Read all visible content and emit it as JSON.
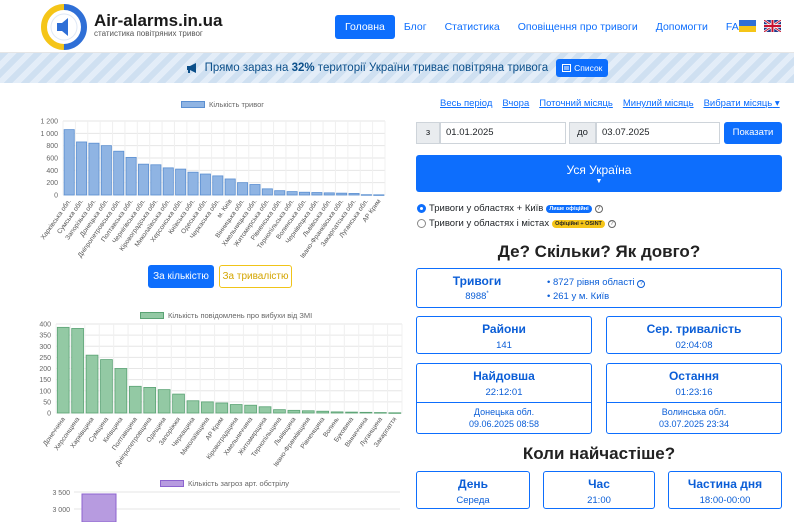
{
  "header": {
    "brand": "Air-alarms.in.ua",
    "subtitle": "статистика повітряних тривог",
    "nav": [
      "Головна",
      "Блог",
      "Статистика",
      "Оповіщення про тривоги",
      "Допомогти",
      "FAQs"
    ],
    "active_index": 0
  },
  "banner": {
    "prefix": "Прямо зараз на ",
    "percent": "32%",
    "suffix": " території України триває повітряна тривога",
    "button": "Список"
  },
  "chart1": {
    "legend": "Кількість тривог",
    "color": "#8fb4e3",
    "border": "#5b8fd1",
    "ylim": [
      0,
      1200
    ],
    "yticks": [
      "1 200",
      "1 000",
      "800",
      "600",
      "400",
      "200",
      "0"
    ],
    "categories": [
      "Харківська обл.",
      "Сумська обл.",
      "Запорізька обл.",
      "Донецька обл.",
      "Дніпропетровська обл.",
      "Полтавська обл.",
      "Чернігівська обл.",
      "Кіровоградська обл.",
      "Миколаївська обл.",
      "Херсонська обл.",
      "Київська обл.",
      "Одеська обл.",
      "Черкаська обл.",
      "м. Київ",
      "Вінницька обл.",
      "Хмельницька обл.",
      "Житомирська обл.",
      "Рівненська обл.",
      "Тернопільська обл.",
      "Волинська обл.",
      "Чернівецька обл.",
      "Львівська обл.",
      "Івано-Франківська обл.",
      "Закарпатська обл.",
      "Луганська обл.",
      "АР Крим"
    ],
    "values": [
      1060,
      860,
      840,
      800,
      710,
      610,
      500,
      490,
      440,
      420,
      370,
      340,
      310,
      260,
      200,
      170,
      100,
      70,
      55,
      45,
      40,
      35,
      30,
      25,
      5,
      3
    ]
  },
  "toggle": {
    "count": "За кількістю",
    "duration": "За тривалістю"
  },
  "chart2": {
    "legend": "Кількість повідомлень про вибухи від ЗМІ",
    "color": "#93c9a4",
    "border": "#5aa374",
    "ylim": [
      0,
      400
    ],
    "yticks": [
      "400",
      "350",
      "300",
      "250",
      "200",
      "150",
      "100",
      "50",
      "0"
    ],
    "categories": [
      "Донеччина",
      "Херсонщина",
      "Харківщина",
      "Сумщина",
      "Київщина",
      "Полтавщина",
      "Дніпропетровщина",
      "Одещина",
      "Запоріжжя",
      "Черкащина",
      "Миколаївщина",
      "АР Крим",
      "Кіровоградщина",
      "Хмельниччина",
      "Житомирщина",
      "Тернопільщина",
      "Львівщина",
      "Івано-Франківщина",
      "Рівненщина",
      "Волинь",
      "Буковина",
      "Вінниччина",
      "Луганщина",
      "Закарпаття"
    ],
    "values": [
      385,
      380,
      260,
      240,
      200,
      120,
      115,
      105,
      85,
      55,
      50,
      45,
      38,
      35,
      28,
      15,
      12,
      10,
      8,
      5,
      4,
      3,
      2,
      1
    ]
  },
  "chart3": {
    "legend": "Кількість загроз арт. обстрілу",
    "color": "#b79be0",
    "border": "#8c63cf",
    "yticks": [
      "3 500",
      "3 000"
    ]
  },
  "periods": [
    "Весь період",
    "Вчора",
    "Поточний місяць",
    "Минулий місяць",
    "Вибрати місяць"
  ],
  "date_from_label": "з",
  "date_from": "01.01.2025",
  "date_to_label": "до",
  "date_to": "03.07.2025",
  "show_button": "Показати",
  "region_button": "Уся Україна",
  "radio1": {
    "label": "Тривоги у областях + Київ",
    "badge": "Лише офіційні"
  },
  "radio2": {
    "label": "Тривоги у областях і містах",
    "badge": "Офіційні + OSINT"
  },
  "section1_title": "Де? Скільки? Як довго?",
  "alarms_card": {
    "title": "Тривоги",
    "value": "8988",
    "sup": "*",
    "line1": "8727 рівня області",
    "line2": "261 у м. Київ"
  },
  "districts_card": {
    "title": "Райони",
    "value": "141"
  },
  "avg_card": {
    "title": "Сер. тривалість",
    "value": "02:04:08"
  },
  "longest_card": {
    "title": "Найдовша",
    "value": "22:12:01",
    "region": "Донецька обл.",
    "date": "09.06.2025 08:58"
  },
  "last_card": {
    "title": "Остання",
    "value": "01:23:16",
    "region": "Волинська обл.",
    "date": "03.07.2025 23:34"
  },
  "section2_title": "Коли найчастіше?",
  "day_card": {
    "title": "День",
    "value": "Середа"
  },
  "hour_card": {
    "title": "Час",
    "value": "21:00"
  },
  "part_card": {
    "title": "Частина дня",
    "value": "18:00-00:00"
  }
}
